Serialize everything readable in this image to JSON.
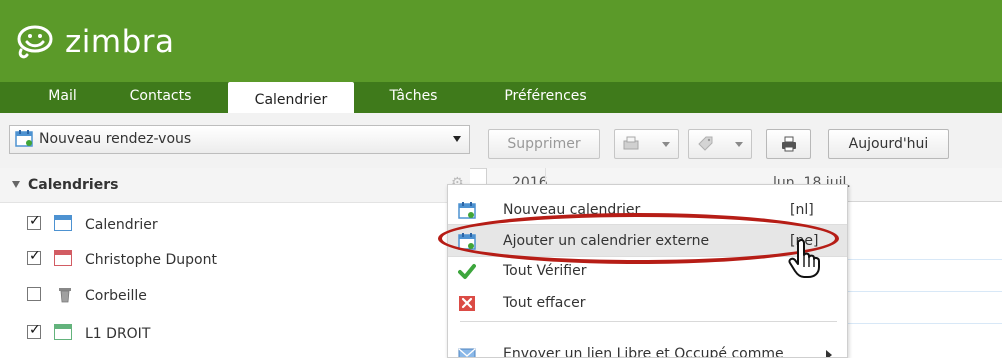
{
  "app": {
    "brand": "zimbra",
    "colors": {
      "header_green": "#5b9a29",
      "tab_green": "#3f7a1b",
      "highlight_red": "#b61d16"
    }
  },
  "tabs": [
    {
      "label": "Mail"
    },
    {
      "label": "Contacts"
    },
    {
      "label": "Calendrier",
      "active": true
    },
    {
      "label": "Tâches"
    },
    {
      "label": "Préférences"
    }
  ],
  "toolbar": {
    "new_appointment": "Nouveau rendez-vous",
    "delete": "Supprimer",
    "today": "Aujourd'hui"
  },
  "sidebar": {
    "title": "Calendriers",
    "calendars": [
      {
        "name": "Calendrier",
        "checked": true,
        "icon": "blue-calendar-icon"
      },
      {
        "name": "Christophe Dupont",
        "checked": true,
        "icon": "red-calendar-icon"
      },
      {
        "name": "Corbeille",
        "checked": false,
        "icon": "trash-icon"
      },
      {
        "name": "L1 DROIT",
        "checked": true,
        "icon": "green-calendar-icon"
      }
    ]
  },
  "calendar_view": {
    "year": "2016",
    "day": "lun. 18 juil."
  },
  "context_menu": {
    "items": [
      {
        "label": "Nouveau calendrier",
        "shortcut": "[nl]",
        "icon": "new-calendar-icon"
      },
      {
        "label": "Ajouter un calendrier externe",
        "shortcut": "[ne]",
        "icon": "external-calendar-icon"
      },
      {
        "label": "Tout Vérifier",
        "shortcut": "",
        "icon": "check-icon"
      },
      {
        "label": "Tout effacer",
        "shortcut": "",
        "icon": "clear-icon"
      },
      {
        "label": "Envoyer un lien Libre et Occupé comme",
        "shortcut": "",
        "icon": "email-icon"
      }
    ]
  }
}
